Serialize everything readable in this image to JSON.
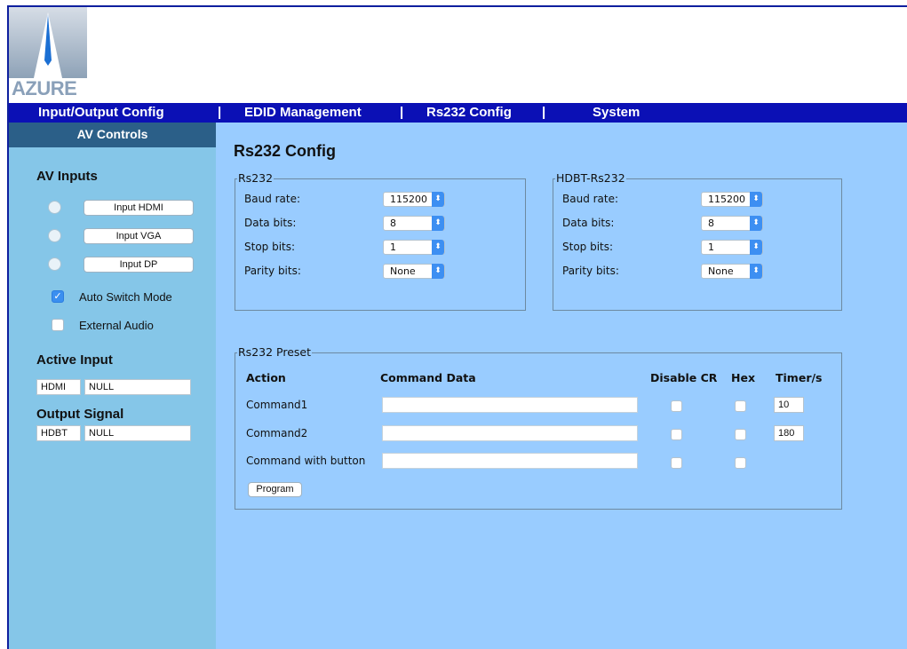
{
  "brand": {
    "logo_text": "AZURE",
    "accent": "#0b10b5",
    "sidebar_bg": "#85c6e8",
    "main_bg": "#99ccff"
  },
  "nav": {
    "items": [
      "Input/Output Config",
      "EDID Management",
      "Rs232 Config",
      "System"
    ],
    "separator": "|"
  },
  "sidebar": {
    "header": "AV Controls",
    "av_inputs_title": "AV Inputs",
    "inputs": [
      {
        "label": "Input HDMI",
        "selected": false
      },
      {
        "label": "Input VGA",
        "selected": false
      },
      {
        "label": "Input DP",
        "selected": false
      }
    ],
    "auto_switch": {
      "label": "Auto Switch Mode",
      "checked": true,
      "mark": "✓"
    },
    "external_audio": {
      "label": "External Audio",
      "checked": false
    },
    "active_input_title": "Active Input",
    "active_input": {
      "source": "HDMI",
      "value": "NULL"
    },
    "output_signal_title": "Output Signal",
    "output_signal": {
      "source": "HDBT",
      "value": "NULL"
    }
  },
  "main": {
    "title": "Rs232 Config",
    "rs232": {
      "legend": "Rs232",
      "rows": [
        {
          "label": "Baud rate:",
          "value": "115200"
        },
        {
          "label": "Data bits:",
          "value": "8"
        },
        {
          "label": "Stop bits:",
          "value": "1"
        },
        {
          "label": "Parity bits:",
          "value": "None"
        }
      ]
    },
    "hdbt_rs232": {
      "legend": "HDBT-Rs232",
      "rows": [
        {
          "label": "Baud rate:",
          "value": "115200"
        },
        {
          "label": "Data bits:",
          "value": "8"
        },
        {
          "label": "Stop bits:",
          "value": "1"
        },
        {
          "label": "Parity bits:",
          "value": "None"
        }
      ]
    },
    "preset": {
      "legend": "Rs232 Preset",
      "columns": [
        "Action",
        "Command Data",
        "Disable CR",
        "Hex",
        "Timer/s"
      ],
      "rows": [
        {
          "action": "Command1",
          "data": "",
          "disable_cr": false,
          "hex": false,
          "timer": "10"
        },
        {
          "action": "Command2",
          "data": "",
          "disable_cr": false,
          "hex": false,
          "timer": "180"
        },
        {
          "action": "Command with button",
          "data": "",
          "disable_cr": false,
          "hex": false
        }
      ],
      "program_label": "Program"
    },
    "select_arrow": "⬍"
  }
}
